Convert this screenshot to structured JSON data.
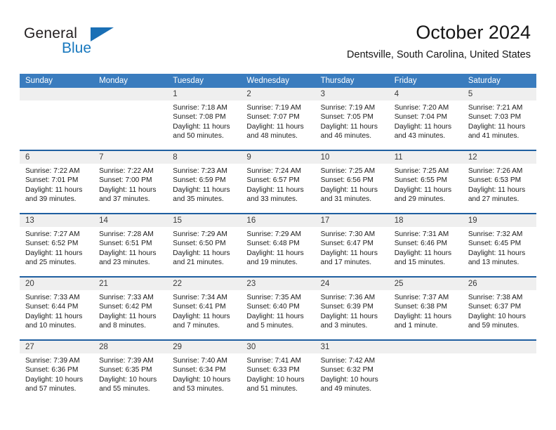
{
  "logo": {
    "word_top": "General",
    "word_bottom": "Blue",
    "accent_color": "#1a6fb5"
  },
  "header": {
    "title": "October 2024",
    "subtitle": "Dentsville, South Carolina, United States"
  },
  "calendar": {
    "header_bg": "#3a7cbe",
    "row_divider_color": "#1f5fa0",
    "day_band_bg": "#efefef",
    "day_names": [
      "Sunday",
      "Monday",
      "Tuesday",
      "Wednesday",
      "Thursday",
      "Friday",
      "Saturday"
    ],
    "weeks": [
      [
        {
          "day": "",
          "sunrise": "",
          "sunset": "",
          "daylight_1": "",
          "daylight_2": ""
        },
        {
          "day": "",
          "sunrise": "",
          "sunset": "",
          "daylight_1": "",
          "daylight_2": ""
        },
        {
          "day": "1",
          "sunrise": "Sunrise: 7:18 AM",
          "sunset": "Sunset: 7:08 PM",
          "daylight_1": "Daylight: 11 hours",
          "daylight_2": "and 50 minutes."
        },
        {
          "day": "2",
          "sunrise": "Sunrise: 7:19 AM",
          "sunset": "Sunset: 7:07 PM",
          "daylight_1": "Daylight: 11 hours",
          "daylight_2": "and 48 minutes."
        },
        {
          "day": "3",
          "sunrise": "Sunrise: 7:19 AM",
          "sunset": "Sunset: 7:05 PM",
          "daylight_1": "Daylight: 11 hours",
          "daylight_2": "and 46 minutes."
        },
        {
          "day": "4",
          "sunrise": "Sunrise: 7:20 AM",
          "sunset": "Sunset: 7:04 PM",
          "daylight_1": "Daylight: 11 hours",
          "daylight_2": "and 43 minutes."
        },
        {
          "day": "5",
          "sunrise": "Sunrise: 7:21 AM",
          "sunset": "Sunset: 7:03 PM",
          "daylight_1": "Daylight: 11 hours",
          "daylight_2": "and 41 minutes."
        }
      ],
      [
        {
          "day": "6",
          "sunrise": "Sunrise: 7:22 AM",
          "sunset": "Sunset: 7:01 PM",
          "daylight_1": "Daylight: 11 hours",
          "daylight_2": "and 39 minutes."
        },
        {
          "day": "7",
          "sunrise": "Sunrise: 7:22 AM",
          "sunset": "Sunset: 7:00 PM",
          "daylight_1": "Daylight: 11 hours",
          "daylight_2": "and 37 minutes."
        },
        {
          "day": "8",
          "sunrise": "Sunrise: 7:23 AM",
          "sunset": "Sunset: 6:59 PM",
          "daylight_1": "Daylight: 11 hours",
          "daylight_2": "and 35 minutes."
        },
        {
          "day": "9",
          "sunrise": "Sunrise: 7:24 AM",
          "sunset": "Sunset: 6:57 PM",
          "daylight_1": "Daylight: 11 hours",
          "daylight_2": "and 33 minutes."
        },
        {
          "day": "10",
          "sunrise": "Sunrise: 7:25 AM",
          "sunset": "Sunset: 6:56 PM",
          "daylight_1": "Daylight: 11 hours",
          "daylight_2": "and 31 minutes."
        },
        {
          "day": "11",
          "sunrise": "Sunrise: 7:25 AM",
          "sunset": "Sunset: 6:55 PM",
          "daylight_1": "Daylight: 11 hours",
          "daylight_2": "and 29 minutes."
        },
        {
          "day": "12",
          "sunrise": "Sunrise: 7:26 AM",
          "sunset": "Sunset: 6:53 PM",
          "daylight_1": "Daylight: 11 hours",
          "daylight_2": "and 27 minutes."
        }
      ],
      [
        {
          "day": "13",
          "sunrise": "Sunrise: 7:27 AM",
          "sunset": "Sunset: 6:52 PM",
          "daylight_1": "Daylight: 11 hours",
          "daylight_2": "and 25 minutes."
        },
        {
          "day": "14",
          "sunrise": "Sunrise: 7:28 AM",
          "sunset": "Sunset: 6:51 PM",
          "daylight_1": "Daylight: 11 hours",
          "daylight_2": "and 23 minutes."
        },
        {
          "day": "15",
          "sunrise": "Sunrise: 7:29 AM",
          "sunset": "Sunset: 6:50 PM",
          "daylight_1": "Daylight: 11 hours",
          "daylight_2": "and 21 minutes."
        },
        {
          "day": "16",
          "sunrise": "Sunrise: 7:29 AM",
          "sunset": "Sunset: 6:48 PM",
          "daylight_1": "Daylight: 11 hours",
          "daylight_2": "and 19 minutes."
        },
        {
          "day": "17",
          "sunrise": "Sunrise: 7:30 AM",
          "sunset": "Sunset: 6:47 PM",
          "daylight_1": "Daylight: 11 hours",
          "daylight_2": "and 17 minutes."
        },
        {
          "day": "18",
          "sunrise": "Sunrise: 7:31 AM",
          "sunset": "Sunset: 6:46 PM",
          "daylight_1": "Daylight: 11 hours",
          "daylight_2": "and 15 minutes."
        },
        {
          "day": "19",
          "sunrise": "Sunrise: 7:32 AM",
          "sunset": "Sunset: 6:45 PM",
          "daylight_1": "Daylight: 11 hours",
          "daylight_2": "and 13 minutes."
        }
      ],
      [
        {
          "day": "20",
          "sunrise": "Sunrise: 7:33 AM",
          "sunset": "Sunset: 6:44 PM",
          "daylight_1": "Daylight: 11 hours",
          "daylight_2": "and 10 minutes."
        },
        {
          "day": "21",
          "sunrise": "Sunrise: 7:33 AM",
          "sunset": "Sunset: 6:42 PM",
          "daylight_1": "Daylight: 11 hours",
          "daylight_2": "and 8 minutes."
        },
        {
          "day": "22",
          "sunrise": "Sunrise: 7:34 AM",
          "sunset": "Sunset: 6:41 PM",
          "daylight_1": "Daylight: 11 hours",
          "daylight_2": "and 7 minutes."
        },
        {
          "day": "23",
          "sunrise": "Sunrise: 7:35 AM",
          "sunset": "Sunset: 6:40 PM",
          "daylight_1": "Daylight: 11 hours",
          "daylight_2": "and 5 minutes."
        },
        {
          "day": "24",
          "sunrise": "Sunrise: 7:36 AM",
          "sunset": "Sunset: 6:39 PM",
          "daylight_1": "Daylight: 11 hours",
          "daylight_2": "and 3 minutes."
        },
        {
          "day": "25",
          "sunrise": "Sunrise: 7:37 AM",
          "sunset": "Sunset: 6:38 PM",
          "daylight_1": "Daylight: 11 hours",
          "daylight_2": "and 1 minute."
        },
        {
          "day": "26",
          "sunrise": "Sunrise: 7:38 AM",
          "sunset": "Sunset: 6:37 PM",
          "daylight_1": "Daylight: 10 hours",
          "daylight_2": "and 59 minutes."
        }
      ],
      [
        {
          "day": "27",
          "sunrise": "Sunrise: 7:39 AM",
          "sunset": "Sunset: 6:36 PM",
          "daylight_1": "Daylight: 10 hours",
          "daylight_2": "and 57 minutes."
        },
        {
          "day": "28",
          "sunrise": "Sunrise: 7:39 AM",
          "sunset": "Sunset: 6:35 PM",
          "daylight_1": "Daylight: 10 hours",
          "daylight_2": "and 55 minutes."
        },
        {
          "day": "29",
          "sunrise": "Sunrise: 7:40 AM",
          "sunset": "Sunset: 6:34 PM",
          "daylight_1": "Daylight: 10 hours",
          "daylight_2": "and 53 minutes."
        },
        {
          "day": "30",
          "sunrise": "Sunrise: 7:41 AM",
          "sunset": "Sunset: 6:33 PM",
          "daylight_1": "Daylight: 10 hours",
          "daylight_2": "and 51 minutes."
        },
        {
          "day": "31",
          "sunrise": "Sunrise: 7:42 AM",
          "sunset": "Sunset: 6:32 PM",
          "daylight_1": "Daylight: 10 hours",
          "daylight_2": "and 49 minutes."
        },
        {
          "day": "",
          "sunrise": "",
          "sunset": "",
          "daylight_1": "",
          "daylight_2": ""
        },
        {
          "day": "",
          "sunrise": "",
          "sunset": "",
          "daylight_1": "",
          "daylight_2": ""
        }
      ]
    ]
  }
}
